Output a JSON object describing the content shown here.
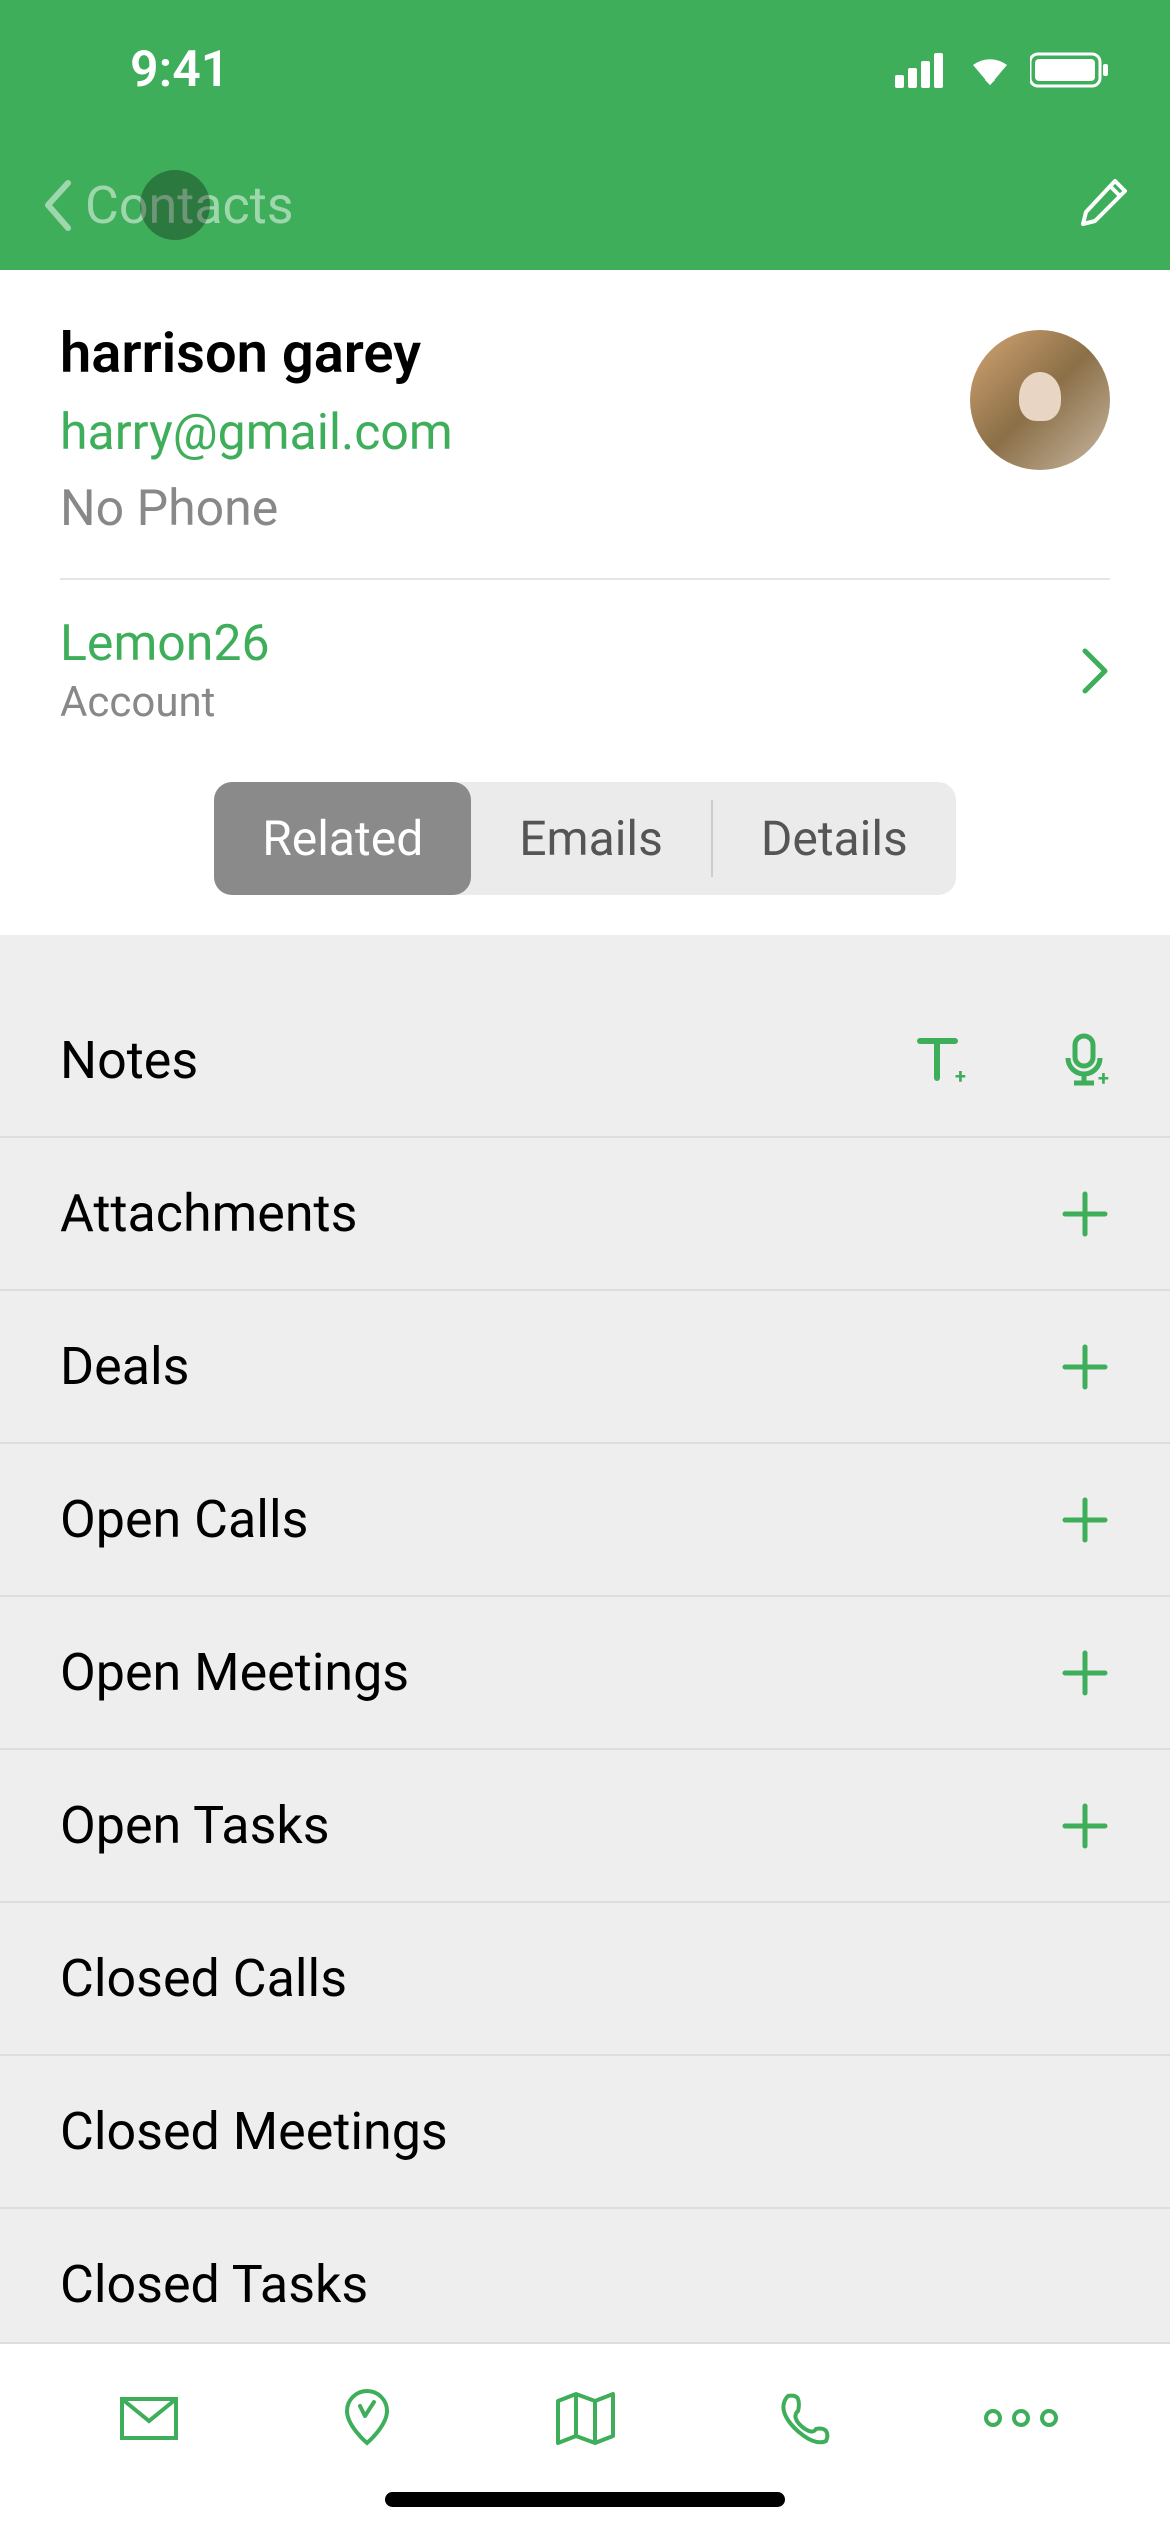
{
  "status": {
    "time": "9:41"
  },
  "nav": {
    "back_label": "Contacts"
  },
  "contact": {
    "name": "harrison garey",
    "email": "harry@gmail.com",
    "phone_label": "No Phone"
  },
  "account": {
    "name": "Lemon26",
    "label": "Account"
  },
  "tabs": {
    "related": "Related",
    "emails": "Emails",
    "details": "Details"
  },
  "list": {
    "notes": "Notes",
    "attachments": "Attachments",
    "deals": "Deals",
    "open_calls": "Open Calls",
    "open_meetings": "Open Meetings",
    "open_tasks": "Open Tasks",
    "closed_calls": "Closed Calls",
    "closed_meetings": "Closed Meetings",
    "closed_tasks": "Closed Tasks"
  }
}
